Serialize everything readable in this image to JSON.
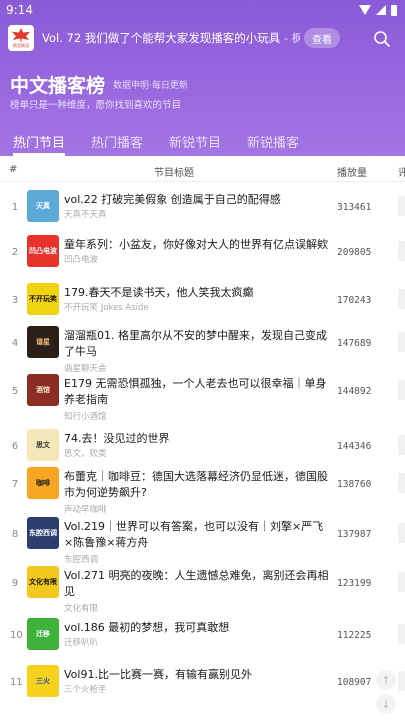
{
  "status": {
    "time": "9:14"
  },
  "banner": {
    "logo_text": "枫言枫语",
    "text": "Vol. 72 我们做了个能帮大家发现播客的小玩具",
    "author": " - 枫言枫语",
    "button": "查看"
  },
  "page": {
    "title": "中文播客榜",
    "subtitle": "数据申明·每日更新",
    "description": "榜单只是一种维度，愿你找到喜欢的节目"
  },
  "tabs": [
    "热门节目",
    "热门播客",
    "新锐节目",
    "新锐播客"
  ],
  "table": {
    "headers": {
      "num": "#",
      "title": "节目标题",
      "plays": "播放量",
      "extra": "评"
    },
    "rows": [
      {
        "num": "1",
        "title": "vol.22 打破完美假象 创造属于自己的配得感",
        "author": "天真不天真",
        "plays": "313461"
      },
      {
        "num": "2",
        "title": "童年系列：小盆友，你好像对大人的世界有亿点误解欸",
        "author": "凹凸电波",
        "plays": "209805"
      },
      {
        "num": "3",
        "title": "179.春天不是读书天，他人笑我太疯癫",
        "author": "不开玩笑 Jokes Aside",
        "plays": "170243"
      },
      {
        "num": "4",
        "title": "溜溜瓶01. 格里高尔从不安的梦中醒来，发现自己变成了牛马",
        "author": "谐星聊天会",
        "plays": "147689"
      },
      {
        "num": "5",
        "title": "E179 无需恐惧孤独，一个人老去也可以很幸福｜单身养老指南",
        "author": "知行小酒馆",
        "plays": "144892"
      },
      {
        "num": "6",
        "title": "74.去！没见过的世界",
        "author": "思文，败类",
        "plays": "144346"
      },
      {
        "num": "7",
        "title": "布蕾克｜咖啡豆：德国大选落幕经济仍显低迷，德国股市为何逆势飙升?",
        "author": "声动早咖啡",
        "plays": "138760"
      },
      {
        "num": "8",
        "title": "Vol.219｜世界可以有答案，也可以没有｜刘擎×严飞×陈鲁豫×蒋方舟",
        "author": "东腔西调",
        "plays": "137987"
      },
      {
        "num": "9",
        "title": "Vol.271 明亮的夜晚：人生遗憾总难免，离别还会再相见",
        "author": "文化有限",
        "plays": "123199"
      },
      {
        "num": "10",
        "title": "vol.186 最初的梦想，我可真敢想",
        "author": "迁移叭叭",
        "plays": "112225"
      },
      {
        "num": "11",
        "title": "Vol91.比一比赛一赛，有输有赢别见外",
        "author": "三个火枪手",
        "plays": "108907"
      }
    ]
  },
  "covers": [
    {
      "bg": "#5aa9d6",
      "text": "天真",
      "fg": "#ffffff"
    },
    {
      "bg": "#e8332a",
      "text": "凹凸电波",
      "fg": "#ffffff"
    },
    {
      "bg": "#f0d40f",
      "text": "不开玩笑",
      "fg": "#111111"
    },
    {
      "bg": "#2b1f1a",
      "text": "谐星",
      "fg": "#f0c070"
    },
    {
      "bg": "#8c2d24",
      "text": "酒馆",
      "fg": "#f4e2c8"
    },
    {
      "bg": "#f6e7b9",
      "text": "思文",
      "fg": "#333333"
    },
    {
      "bg": "#f5a623",
      "text": "咖啡",
      "fg": "#222222"
    },
    {
      "bg": "#2c3e6e",
      "text": "东腔西调",
      "fg": "#ffffff"
    },
    {
      "bg": "#f2c81d",
      "text": "文化有限",
      "fg": "#111111"
    },
    {
      "bg": "#3fb23c",
      "text": "迁移",
      "fg": "#ffffff"
    },
    {
      "bg": "#f7d21c",
      "text": "三火",
      "fg": "#1e4aa8"
    }
  ],
  "colors": {
    "header_gradient_start": "#8a5bd8",
    "header_gradient_end": "#a579e4",
    "accent": "#ffffff"
  },
  "scroll_buttons": [
    "↑",
    "↓"
  ]
}
